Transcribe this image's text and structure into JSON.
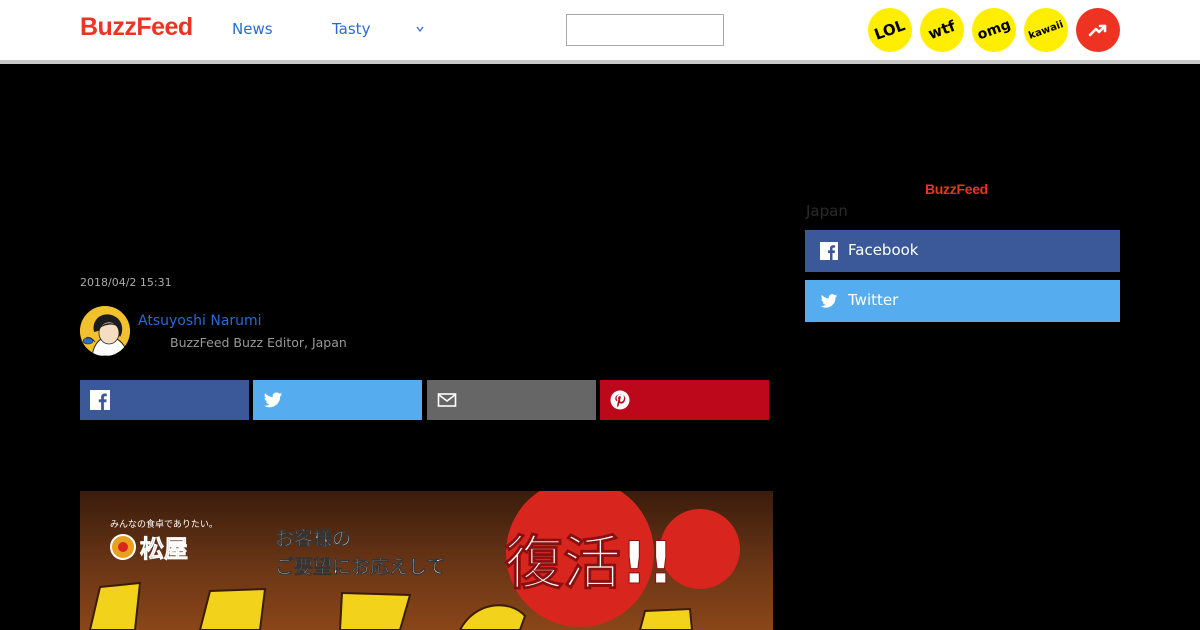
{
  "header": {
    "logo": "BuzzFeed",
    "nav": [
      {
        "label": "News"
      },
      {
        "label": "Tasty"
      }
    ],
    "search": {
      "placeholder": "",
      "value": ""
    },
    "badges": [
      {
        "label": "LOL",
        "color": "#ffee00"
      },
      {
        "label": "wtf",
        "color": "#ffee00"
      },
      {
        "label": "omg",
        "color": "#ffee00"
      },
      {
        "label": "kawaii",
        "color": "#ffee00"
      }
    ],
    "trending_icon": "trending-arrow-icon",
    "trending_color": "#ee3322"
  },
  "sidebar": {
    "logo": "BuzzFeed",
    "region": "Japan",
    "follow": [
      {
        "label": "Facebook",
        "icon": "facebook-icon",
        "color": "#3b5998"
      },
      {
        "label": "Twitter",
        "icon": "twitter-icon",
        "color": "#55acee"
      }
    ]
  },
  "article": {
    "timestamp": "2018/04/2 15:31",
    "author": {
      "name": "Atsuyoshi Narumi",
      "title": "BuzzFeed Buzz Editor, Japan"
    },
    "share": [
      {
        "icon": "facebook-icon",
        "color": "#3b5998"
      },
      {
        "icon": "twitter-icon",
        "color": "#55acee"
      },
      {
        "icon": "mail-icon",
        "color": "#666666"
      },
      {
        "icon": "pinterest-icon",
        "color": "#bd081c"
      }
    ],
    "hero": {
      "tagline": "みんなの食卓でありたい。",
      "brand": "松屋",
      "headline_line1": "お客様の",
      "headline_line2": "ご要望にお応えして",
      "stamp": "復活!!"
    }
  },
  "colors": {
    "brand_red": "#ee3322",
    "link_blue": "#2a6ad4",
    "background": "#000000"
  }
}
